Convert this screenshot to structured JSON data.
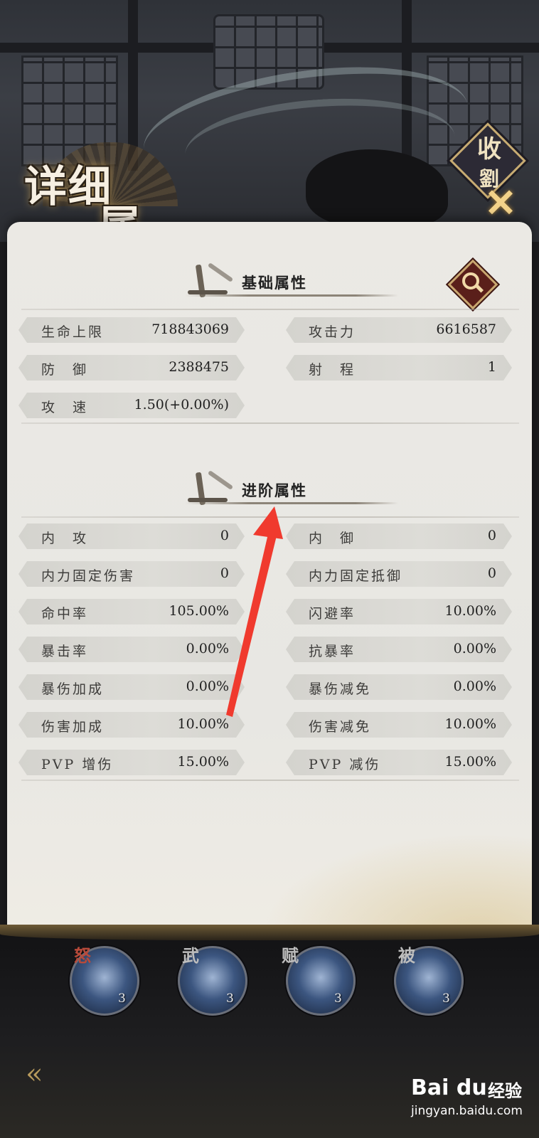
{
  "header": {
    "title_line1": "详细",
    "title_line2": "属性",
    "close_label_line1": "收",
    "close_label_line2": "劉",
    "close_icon": "✕"
  },
  "sections": {
    "basic": {
      "title": "基础属性",
      "left": [
        {
          "label": "生命上限",
          "value": "718843069"
        },
        {
          "label": "防　御",
          "value": "2388475"
        },
        {
          "label": "攻　速",
          "value": "1.50(+0.00%)"
        }
      ],
      "right": [
        {
          "label": "攻击力",
          "value": "6616587"
        },
        {
          "label": "射　程",
          "value": "1"
        }
      ]
    },
    "advanced": {
      "title": "进阶属性",
      "left": [
        {
          "label": "内　攻",
          "value": "0"
        },
        {
          "label": "内力固定伤害",
          "value": "0"
        },
        {
          "label": "命中率",
          "value": "105.00%"
        },
        {
          "label": "暴击率",
          "value": "0.00%"
        },
        {
          "label": "暴伤加成",
          "value": "0.00%"
        },
        {
          "label": "伤害加成",
          "value": "10.00%"
        },
        {
          "label": "PVP 增伤",
          "value": "15.00%"
        }
      ],
      "right": [
        {
          "label": "内　御",
          "value": "0"
        },
        {
          "label": "内力固定抵御",
          "value": "0"
        },
        {
          "label": "闪避率",
          "value": "10.00%"
        },
        {
          "label": "抗暴率",
          "value": "0.00%"
        },
        {
          "label": "暴伤减免",
          "value": "0.00%"
        },
        {
          "label": "伤害减免",
          "value": "10.00%"
        },
        {
          "label": "PVP 减伤",
          "value": "15.00%"
        }
      ]
    }
  },
  "skills": [
    {
      "tag": "怒",
      "level": "3"
    },
    {
      "tag": "武",
      "level": "3"
    },
    {
      "tag": "赋",
      "level": "3"
    },
    {
      "tag": "被",
      "level": "3"
    }
  ],
  "watermark": {
    "brand": "Bai du",
    "brand_cn": "经验",
    "site": "jingyan.baidu.com"
  },
  "colors": {
    "panel": "#e9e8e4",
    "row": "#d8d7d2",
    "accent_gold": "#c9a770",
    "annotation_arrow": "#f03a2e"
  }
}
